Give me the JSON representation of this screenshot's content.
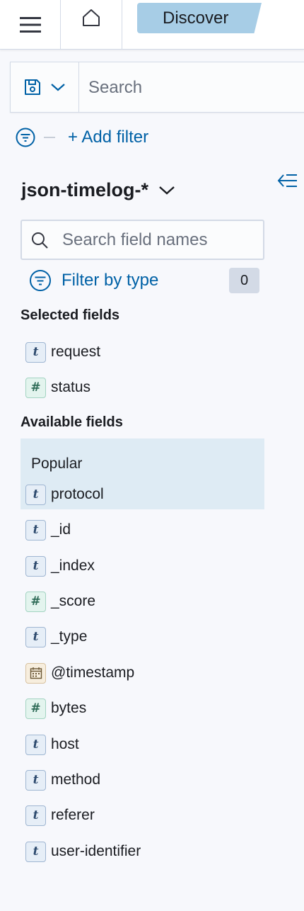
{
  "header": {
    "breadcrumb": "Discover",
    "icons": [
      "menu-icon",
      "home-icon"
    ]
  },
  "query_bar": {
    "save_icon": "save-icon",
    "search_placeholder": "Search"
  },
  "filters": {
    "add_filter_label": "+ Add filter"
  },
  "sidebar": {
    "index_pattern": "json-timelog-*",
    "field_search_placeholder": "Search field names",
    "filter_by_type_label": "Filter by type",
    "filter_count": "0",
    "selected_heading": "Selected fields",
    "selected_fields": [
      {
        "name": "request",
        "type": "t"
      },
      {
        "name": "status",
        "type": "#"
      }
    ],
    "available_heading": "Available fields",
    "popular_heading": "Popular",
    "popular_fields": [
      {
        "name": "protocol",
        "type": "t"
      }
    ],
    "available_fields": [
      {
        "name": "_id",
        "type": "t"
      },
      {
        "name": "_index",
        "type": "t"
      },
      {
        "name": "_score",
        "type": "#"
      },
      {
        "name": "_type",
        "type": "t"
      },
      {
        "name": "@timestamp",
        "type": "date"
      },
      {
        "name": "bytes",
        "type": "#"
      },
      {
        "name": "host",
        "type": "t"
      },
      {
        "name": "method",
        "type": "t"
      },
      {
        "name": "referer",
        "type": "t"
      },
      {
        "name": "user-identifier",
        "type": "t"
      }
    ]
  },
  "colors": {
    "accent": "#0061a6",
    "breadcrumb_bg": "#a7cde6",
    "popular_bg": "#deebf4"
  }
}
